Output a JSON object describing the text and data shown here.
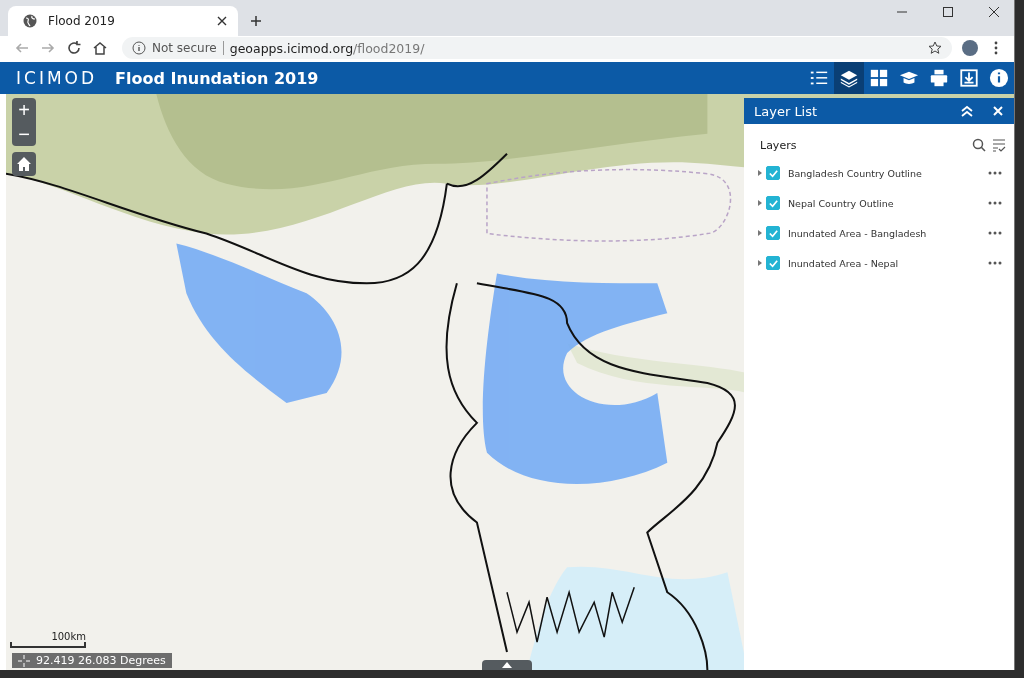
{
  "browser": {
    "tab_title": "Flood 2019",
    "security": "Not secure",
    "url_host": "geoapps.icimod.org",
    "url_path": "/flood2019/"
  },
  "app": {
    "logo": "ICIMOD",
    "title": "Flood Inundation 2019"
  },
  "toolbar": [
    {
      "kind": "legend",
      "selected": false
    },
    {
      "kind": "layers",
      "selected": true
    },
    {
      "kind": "basemap",
      "selected": false
    },
    {
      "kind": "about",
      "selected": false
    },
    {
      "kind": "print",
      "selected": false
    },
    {
      "kind": "download",
      "selected": false
    },
    {
      "kind": "info",
      "selected": false
    }
  ],
  "map_controls": {
    "zoom_in": "+",
    "zoom_out": "−"
  },
  "scale_bar": "100km",
  "coordinates": "92.419 26.083 Degrees",
  "panel": {
    "title": "Layer List",
    "heading": "Layers",
    "layers": [
      {
        "name": "Bangladesh Country Outline",
        "checked": true
      },
      {
        "name": "Nepal Country Outline",
        "checked": true
      },
      {
        "name": "Inundated Area - Bangladesh",
        "checked": true
      },
      {
        "name": "Inundated Area - Nepal",
        "checked": true
      }
    ]
  }
}
